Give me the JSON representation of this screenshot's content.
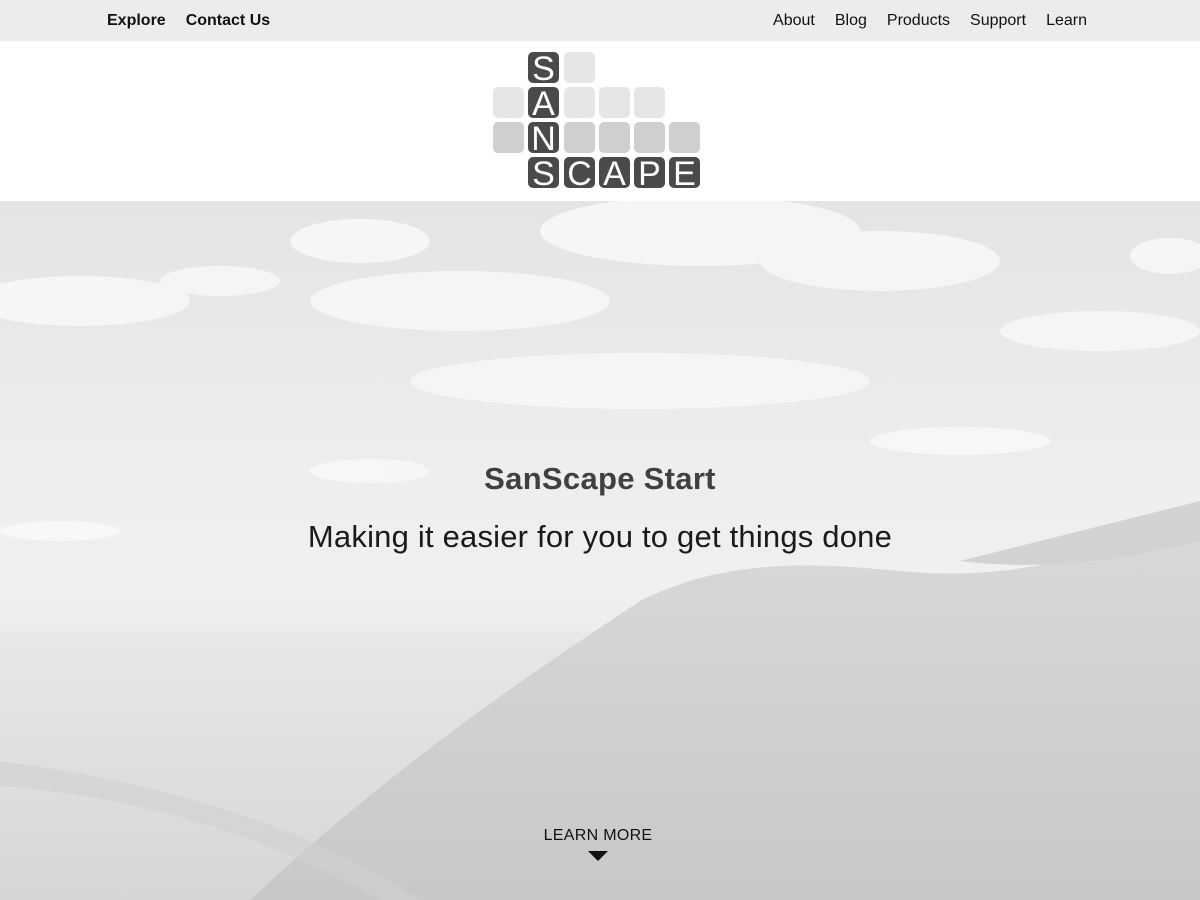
{
  "nav": {
    "left": [
      {
        "label": "Explore"
      },
      {
        "label": "Contact Us"
      }
    ],
    "right": [
      {
        "label": "About"
      },
      {
        "label": "Blog"
      },
      {
        "label": "Products"
      },
      {
        "label": "Support"
      },
      {
        "label": "Learn"
      }
    ]
  },
  "logo": {
    "text": "SANSCAPE",
    "tile_dark": "#4a4a4a",
    "tile_light": "#e6e6e6",
    "tile_mid": "#cfcfcf"
  },
  "hero": {
    "title": "SanScape Start",
    "subtitle": "Making it easier for you to get things done",
    "cta_label": "LEARN MORE",
    "cta_icon": "arrow-down-icon"
  }
}
